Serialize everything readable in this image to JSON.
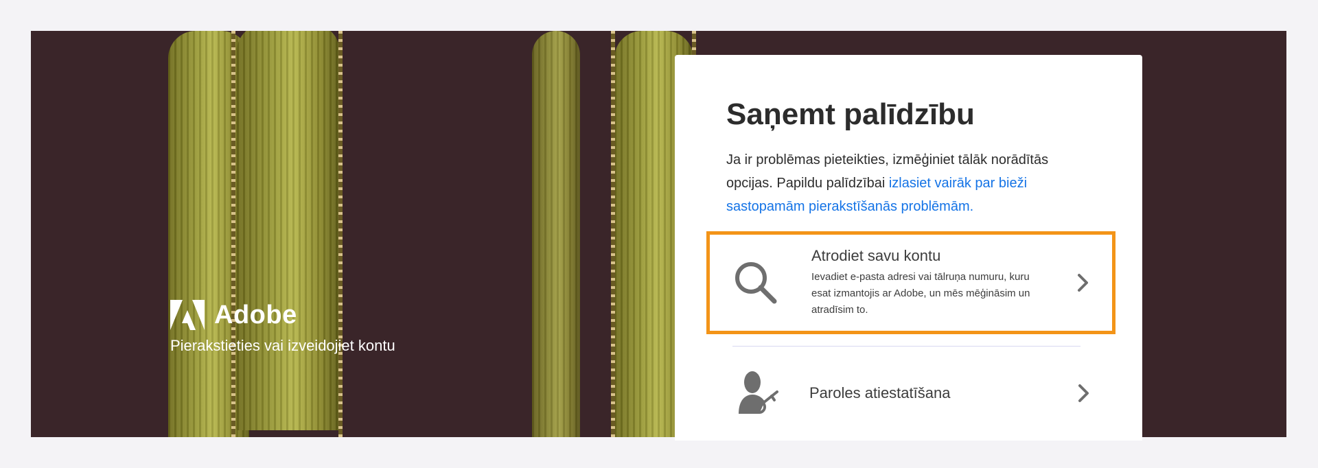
{
  "brand": {
    "name": "Adobe",
    "subtitle": "Pierakstieties vai izveidojiet kontu",
    "logo_icon": "adobe-logo-icon"
  },
  "card": {
    "title": "Saņemt palīdzību",
    "description_prefix": "Ja ir problēmas pieteikties, izmēģiniet tālāk norādītās opcijas. Papildu palīdzībai ",
    "description_link": "izlasiet vairāk par bieži sastopamām pierakstīšanās problēmām.",
    "options": [
      {
        "title": "Atrodiet savu kontu",
        "body": "Ievadiet e-pasta adresi vai tālruņa numuru, kuru esat izmantojis ar Adobe, un mēs mēģināsim un atradīsim to.",
        "icon": "search-icon",
        "highlighted": true
      },
      {
        "title": "Paroles atiestatīšana",
        "icon": "user-key-icon"
      }
    ]
  },
  "colors": {
    "highlight": "#f39418",
    "link": "#1473e6",
    "hero_bg": "#3a2529",
    "icon": "#6e6e6e"
  }
}
